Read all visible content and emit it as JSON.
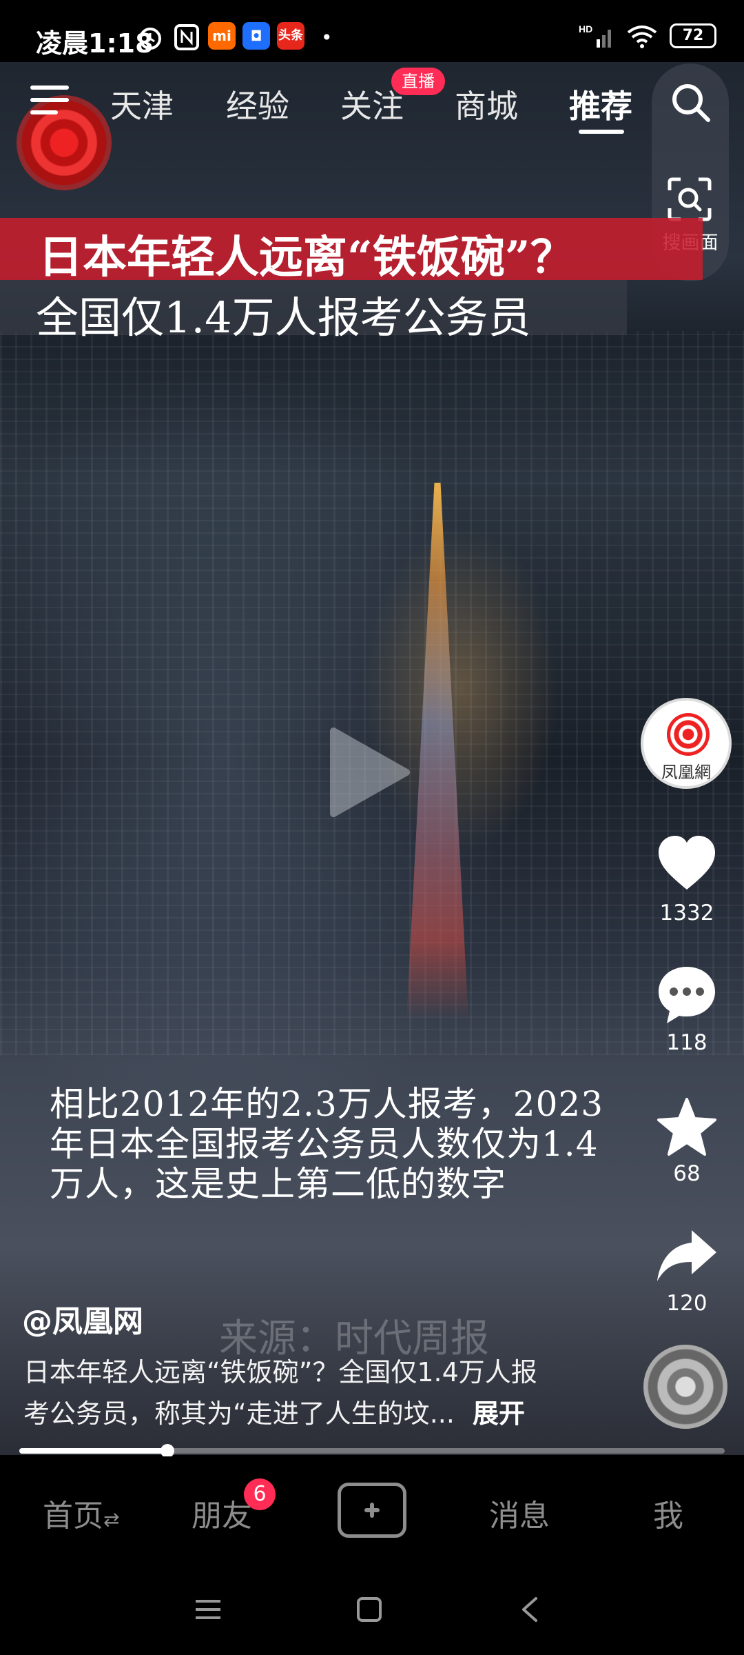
{
  "status_bar": {
    "time": "凌晨1:18",
    "app_icons": [
      "alarm-icon",
      "nfc-icon",
      "mi-icon",
      "app-icon",
      "toutiao-icon"
    ],
    "toutiao_label": "头条",
    "mi_label": "mi",
    "battery": "72",
    "network": "HD"
  },
  "top_nav": {
    "tabs": [
      {
        "label": "天津",
        "active": false
      },
      {
        "label": "经验",
        "active": false
      },
      {
        "label": "关注",
        "active": false
      },
      {
        "label": "商城",
        "active": false
      },
      {
        "label": "推荐",
        "active": true
      }
    ],
    "live_badge": "直播",
    "scan_label": "搜画面"
  },
  "video": {
    "headline": "日本年轻人远离“铁饭碗”？",
    "subheadline": "全国仅1.4万人报考公务员",
    "caption_lines": [
      "相比2012年的2.3万人报考，2023",
      "年日本全国报考公务员人数仅为1.4",
      "万人，这是史上第二低的数字"
    ],
    "source_watermark": "来源：时代周报"
  },
  "actions": {
    "avatar_name": "凤凰網",
    "likes": "1332",
    "comments": "118",
    "favorites": "68",
    "shares": "120"
  },
  "post": {
    "author": "@凤凰网",
    "description_line1": "日本年轻人远离“铁饭碗”？全国仅1.4万人报",
    "description_line2": "考公务员，称其为“走进了人生的坟...",
    "expand_label": "展开",
    "progress": 0.21
  },
  "bottom_nav": {
    "home": "首页",
    "friends": "朋友",
    "friends_badge": "6",
    "messages": "消息",
    "me": "我"
  },
  "colors": {
    "accent_red": "#ff2c55",
    "banner_red": "#c81e2d",
    "inactive_gray": "#8d8d8d"
  }
}
